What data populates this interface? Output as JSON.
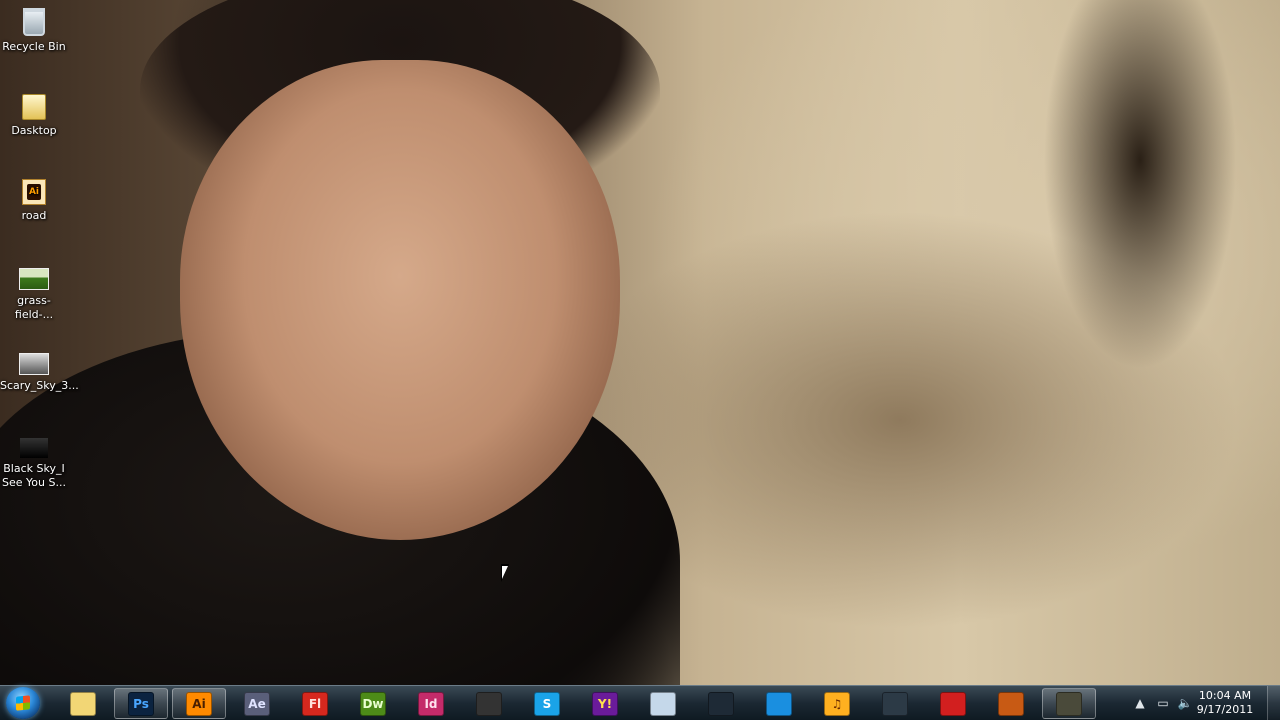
{
  "desktop_icons": [
    {
      "label": "Recycle Bin",
      "icon": "recycle-bin-icon"
    },
    {
      "label": "Dasktop",
      "icon": "folder-icon"
    },
    {
      "label": "road",
      "icon": "illustrator-file-icon",
      "badge": "Ai"
    },
    {
      "label": "grass-field-...",
      "icon": "image-file-icon"
    },
    {
      "label": "Scary_Sky_3...",
      "icon": "image-file-icon"
    },
    {
      "label": "Black Sky_I See You S...",
      "icon": "image-file-icon"
    }
  ],
  "taskbar": {
    "apps": [
      {
        "name": "Windows Explorer",
        "icon": "folder-icon",
        "glyph": "",
        "bg": "#f2d675",
        "fg": "#000"
      },
      {
        "name": "Photoshop",
        "icon": "photoshop-icon",
        "glyph": "Ps",
        "bg": "#0b2340",
        "fg": "#49a6ff",
        "active": true
      },
      {
        "name": "Illustrator",
        "icon": "illustrator-icon",
        "glyph": "Ai",
        "bg": "#ff8a00",
        "fg": "#4a1f00",
        "active": true
      },
      {
        "name": "After Effects",
        "icon": "after-effects-icon",
        "glyph": "Ae",
        "bg": "#5a5f7a",
        "fg": "#dfe3ff"
      },
      {
        "name": "Flash",
        "icon": "flash-icon",
        "glyph": "Fl",
        "bg": "#d6281e",
        "fg": "#ffe0da"
      },
      {
        "name": "Dreamweaver",
        "icon": "dreamweaver-icon",
        "glyph": "Dw",
        "bg": "#4d8b18",
        "fg": "#eaffd0"
      },
      {
        "name": "InDesign",
        "icon": "indesign-icon",
        "glyph": "Id",
        "bg": "#c42b6a",
        "fg": "#ffe1ef"
      },
      {
        "name": "Checkerboard App",
        "icon": "checkerboard-icon",
        "glyph": "",
        "bg": "#333",
        "fg": "#fff"
      },
      {
        "name": "Skype",
        "icon": "skype-icon",
        "glyph": "S",
        "bg": "#1aa3e8",
        "fg": "#fff"
      },
      {
        "name": "Yahoo Messenger",
        "icon": "yahoo-messenger-icon",
        "glyph": "Y!",
        "bg": "#6a1b9a",
        "fg": "#ffe14d"
      },
      {
        "name": "Monitor App",
        "icon": "monitor-icon",
        "glyph": "",
        "bg": "#c5d8ea",
        "fg": "#1e4f7a"
      },
      {
        "name": "Eye App",
        "icon": "eye-icon",
        "glyph": "",
        "bg": "#1e2a36",
        "fg": "#fff"
      },
      {
        "name": "TeamViewer",
        "icon": "teamviewer-icon",
        "glyph": "",
        "bg": "#1a8fe0",
        "fg": "#fff"
      },
      {
        "name": "Music Player",
        "icon": "music-note-icon",
        "glyph": "♫",
        "bg": "#ffb020",
        "fg": "#6a2a00"
      },
      {
        "name": "Webcam",
        "icon": "webcam-icon",
        "glyph": "",
        "bg": "#2c3a46",
        "fg": "#9fd9ff"
      },
      {
        "name": "Record App",
        "icon": "record-icon",
        "glyph": "",
        "bg": "#d21f1f",
        "fg": "#fff"
      },
      {
        "name": "Monkey App",
        "icon": "monkey-icon",
        "glyph": "",
        "bg": "#c85a14",
        "fg": "#ffe0b0"
      },
      {
        "name": "Camera App",
        "icon": "camera-icon",
        "glyph": "",
        "bg": "#4a4a3a",
        "fg": "#ffe14d",
        "active": true
      }
    ],
    "tray": {
      "time": "10:04 AM",
      "date": "9/17/2011"
    }
  }
}
